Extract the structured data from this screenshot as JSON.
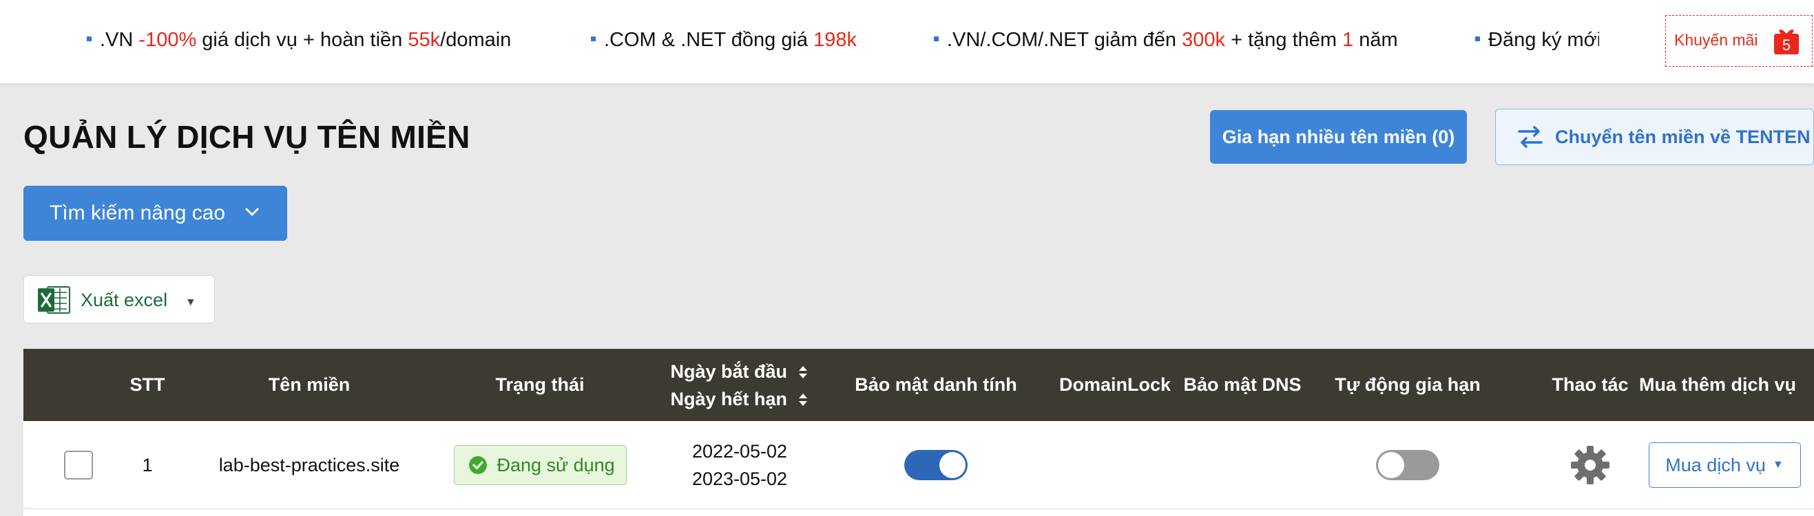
{
  "promos": [
    {
      "pre": ".VN ",
      "hl1": "-100%",
      "mid": " giá dịch vụ + hoàn tiền ",
      "hl2": "55k",
      "post": "/domain"
    },
    {
      "pre": ".COM & .NET đồng giá ",
      "hl1": "198k"
    },
    {
      "pre": ".VN/.COM/.NET giảm đến ",
      "hl1": "300k",
      "mid": " + tặng thêm ",
      "hl2": "1",
      "post": " năm"
    },
    {
      "pre": "Đăng ký mới"
    }
  ],
  "promo_badge": {
    "label": "Khuyến mãi",
    "count": "5"
  },
  "page_title": "QUẢN LÝ DỊCH VỤ TÊN MIỀN",
  "renew_button": "Gia hạn nhiều tên miền (0)",
  "transfer_button": "Chuyển tên miền về TENTEN",
  "search_button": "Tìm kiếm nâng cao",
  "export_button": "Xuất excel",
  "table": {
    "headers": {
      "stt": "STT",
      "domain": "Tên miền",
      "status": "Trạng thái",
      "start_date": "Ngày bắt đầu",
      "end_date": "Ngày hết hạn",
      "privacy": "Bảo mật danh tính",
      "domainlock": "DomainLock",
      "dns_security": "Bảo mật DNS",
      "auto_renew": "Tự động gia hạn",
      "actions": "Thao tác",
      "buy_more": "Mua thêm dịch vụ"
    },
    "rows": [
      {
        "stt": "1",
        "domain": "lab-best-practices.site",
        "status": "Đang sử dụng",
        "start_date": "2022-05-02",
        "end_date": "2023-05-02",
        "privacy_enabled": true,
        "auto_renew_enabled": false,
        "buy_label": "Mua dịch vụ"
      }
    ]
  },
  "colors": {
    "accent": "#3e85d8",
    "header_bg": "#3d3a32",
    "highlight": "#e8281b",
    "success": "#2d8b1e"
  }
}
